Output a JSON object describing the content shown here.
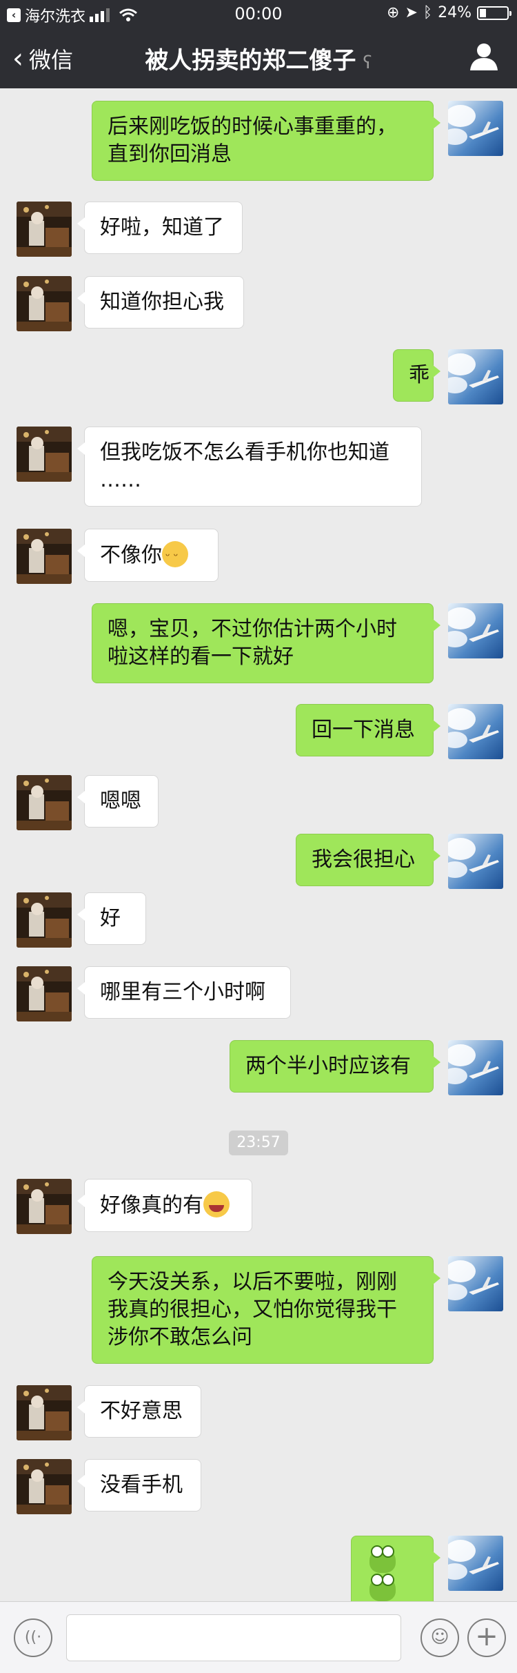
{
  "status_bar": {
    "carrier": "海尔洗衣",
    "time": "00:00",
    "battery": "24%",
    "battery_level": 0.24
  },
  "nav": {
    "back_label": "微信",
    "title": "被人拐卖的郑二傻子"
  },
  "messages": [
    {
      "from": "me",
      "lines": [
        "后来刚吃饭的时候心事重重的，",
        "直到你回消息"
      ]
    },
    {
      "from": "other",
      "lines": [
        "好啦，知道了"
      ]
    },
    {
      "from": "other",
      "lines": [
        "知道你担心我"
      ]
    },
    {
      "from": "me",
      "lines": [
        "乖"
      ]
    },
    {
      "from": "other",
      "lines": [
        "但我吃饭不怎么看手机你也知道",
        "……"
      ]
    },
    {
      "from": "other",
      "lines": [
        "不像你"
      ],
      "emoji": "smirk"
    },
    {
      "from": "me",
      "lines": [
        "嗯，宝贝，不过你估计两个小时",
        "啦这样的看一下就好"
      ]
    },
    {
      "from": "me",
      "lines": [
        "回一下消息"
      ]
    },
    {
      "from": "other",
      "lines": [
        "嗯嗯"
      ]
    },
    {
      "from": "me",
      "lines": [
        "我会很担心"
      ]
    },
    {
      "from": "other",
      "lines": [
        "好"
      ]
    },
    {
      "from": "other",
      "lines": [
        "哪里有三个小时啊"
      ]
    },
    {
      "from": "me",
      "lines": [
        "两个半小时应该有"
      ]
    },
    {
      "timestamp": "23:57"
    },
    {
      "from": "other",
      "lines": [
        "好像真的有"
      ],
      "emoji": "laugh"
    },
    {
      "from": "me",
      "lines": [
        "今天没关系，以后不要啦，刚刚",
        "我真的很担心，又怕你觉得我干",
        "涉你不敢怎么问"
      ]
    },
    {
      "from": "other",
      "lines": [
        "不好意思"
      ]
    },
    {
      "from": "other",
      "lines": [
        "没看手机"
      ]
    },
    {
      "from": "me",
      "lines": [],
      "stickers": [
        "frog",
        "frog"
      ]
    }
  ]
}
